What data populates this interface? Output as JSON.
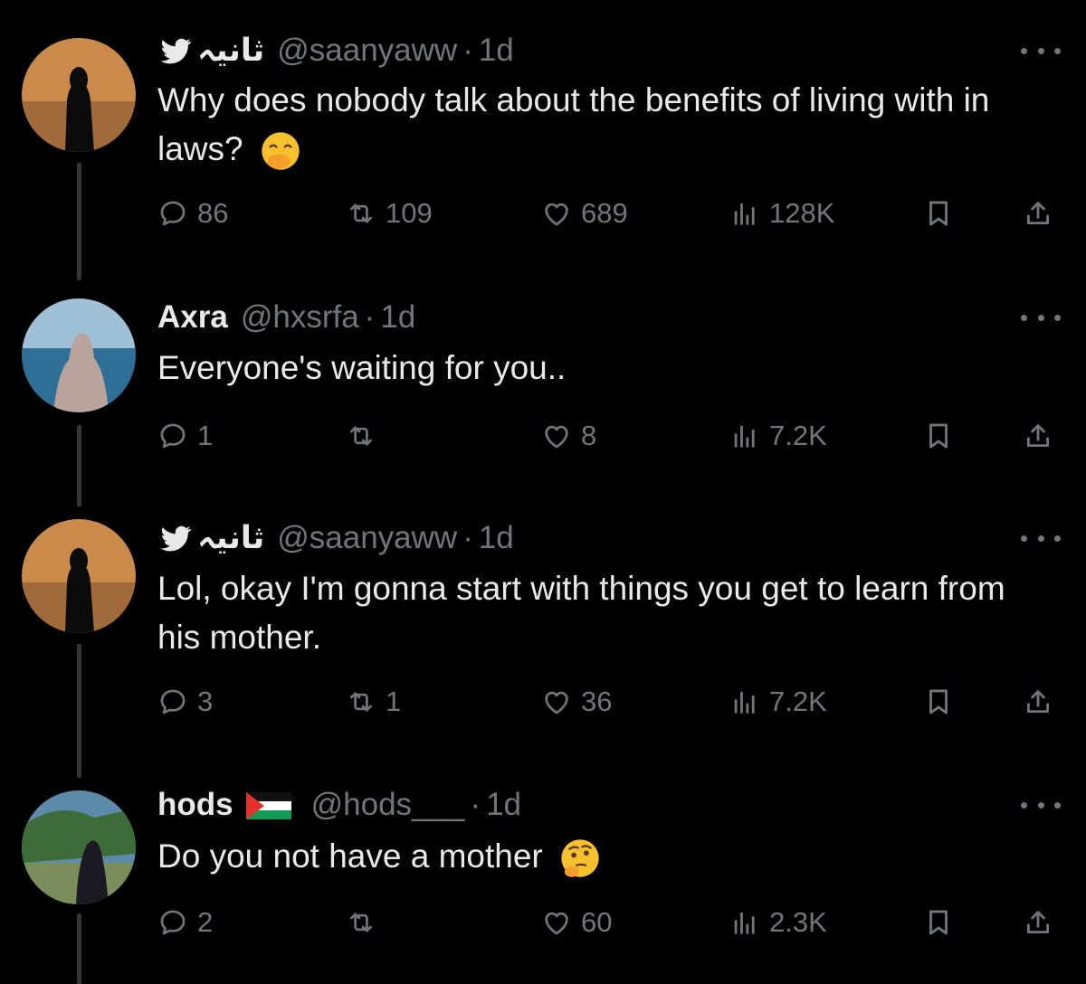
{
  "tweets": [
    {
      "display_name": "ثانیہ",
      "handle": "@saanyaww",
      "separator": "·",
      "time": "1d",
      "text": "Why does nobody talk about the benefits of living with in laws?",
      "emoji": "hand-over-mouth-emoji",
      "replies": "86",
      "retweets": "109",
      "likes": "689",
      "views": "128K"
    },
    {
      "display_name": "Axra",
      "handle": "@hxsrfa",
      "separator": "·",
      "time": "1d",
      "text": "Everyone's waiting for you..",
      "replies": "1",
      "retweets": "",
      "likes": "8",
      "views": "7.2K"
    },
    {
      "display_name": "ثانیہ",
      "handle": "@saanyaww",
      "separator": "·",
      "time": "1d",
      "text": "Lol, okay I'm gonna start with things you get to learn from his mother.",
      "replies": "3",
      "retweets": "1",
      "likes": "36",
      "views": "7.2K"
    },
    {
      "display_name": "hods",
      "handle": "@hods___",
      "separator": "·",
      "time": "1d",
      "text": "Do you not have a mother",
      "emoji": "thinking-face-emoji",
      "replies": "2",
      "retweets": "",
      "likes": "60",
      "views": "2.3K"
    }
  ],
  "colors": {
    "background": "#000000",
    "text": "#e7e9ea",
    "muted": "#71767b",
    "thread_line": "#333639"
  },
  "icons": [
    "bird-icon",
    "reply-icon",
    "retweet-icon",
    "like-icon",
    "views-icon",
    "bookmark-icon",
    "share-icon",
    "more-icon",
    "palestine-flag-icon"
  ]
}
